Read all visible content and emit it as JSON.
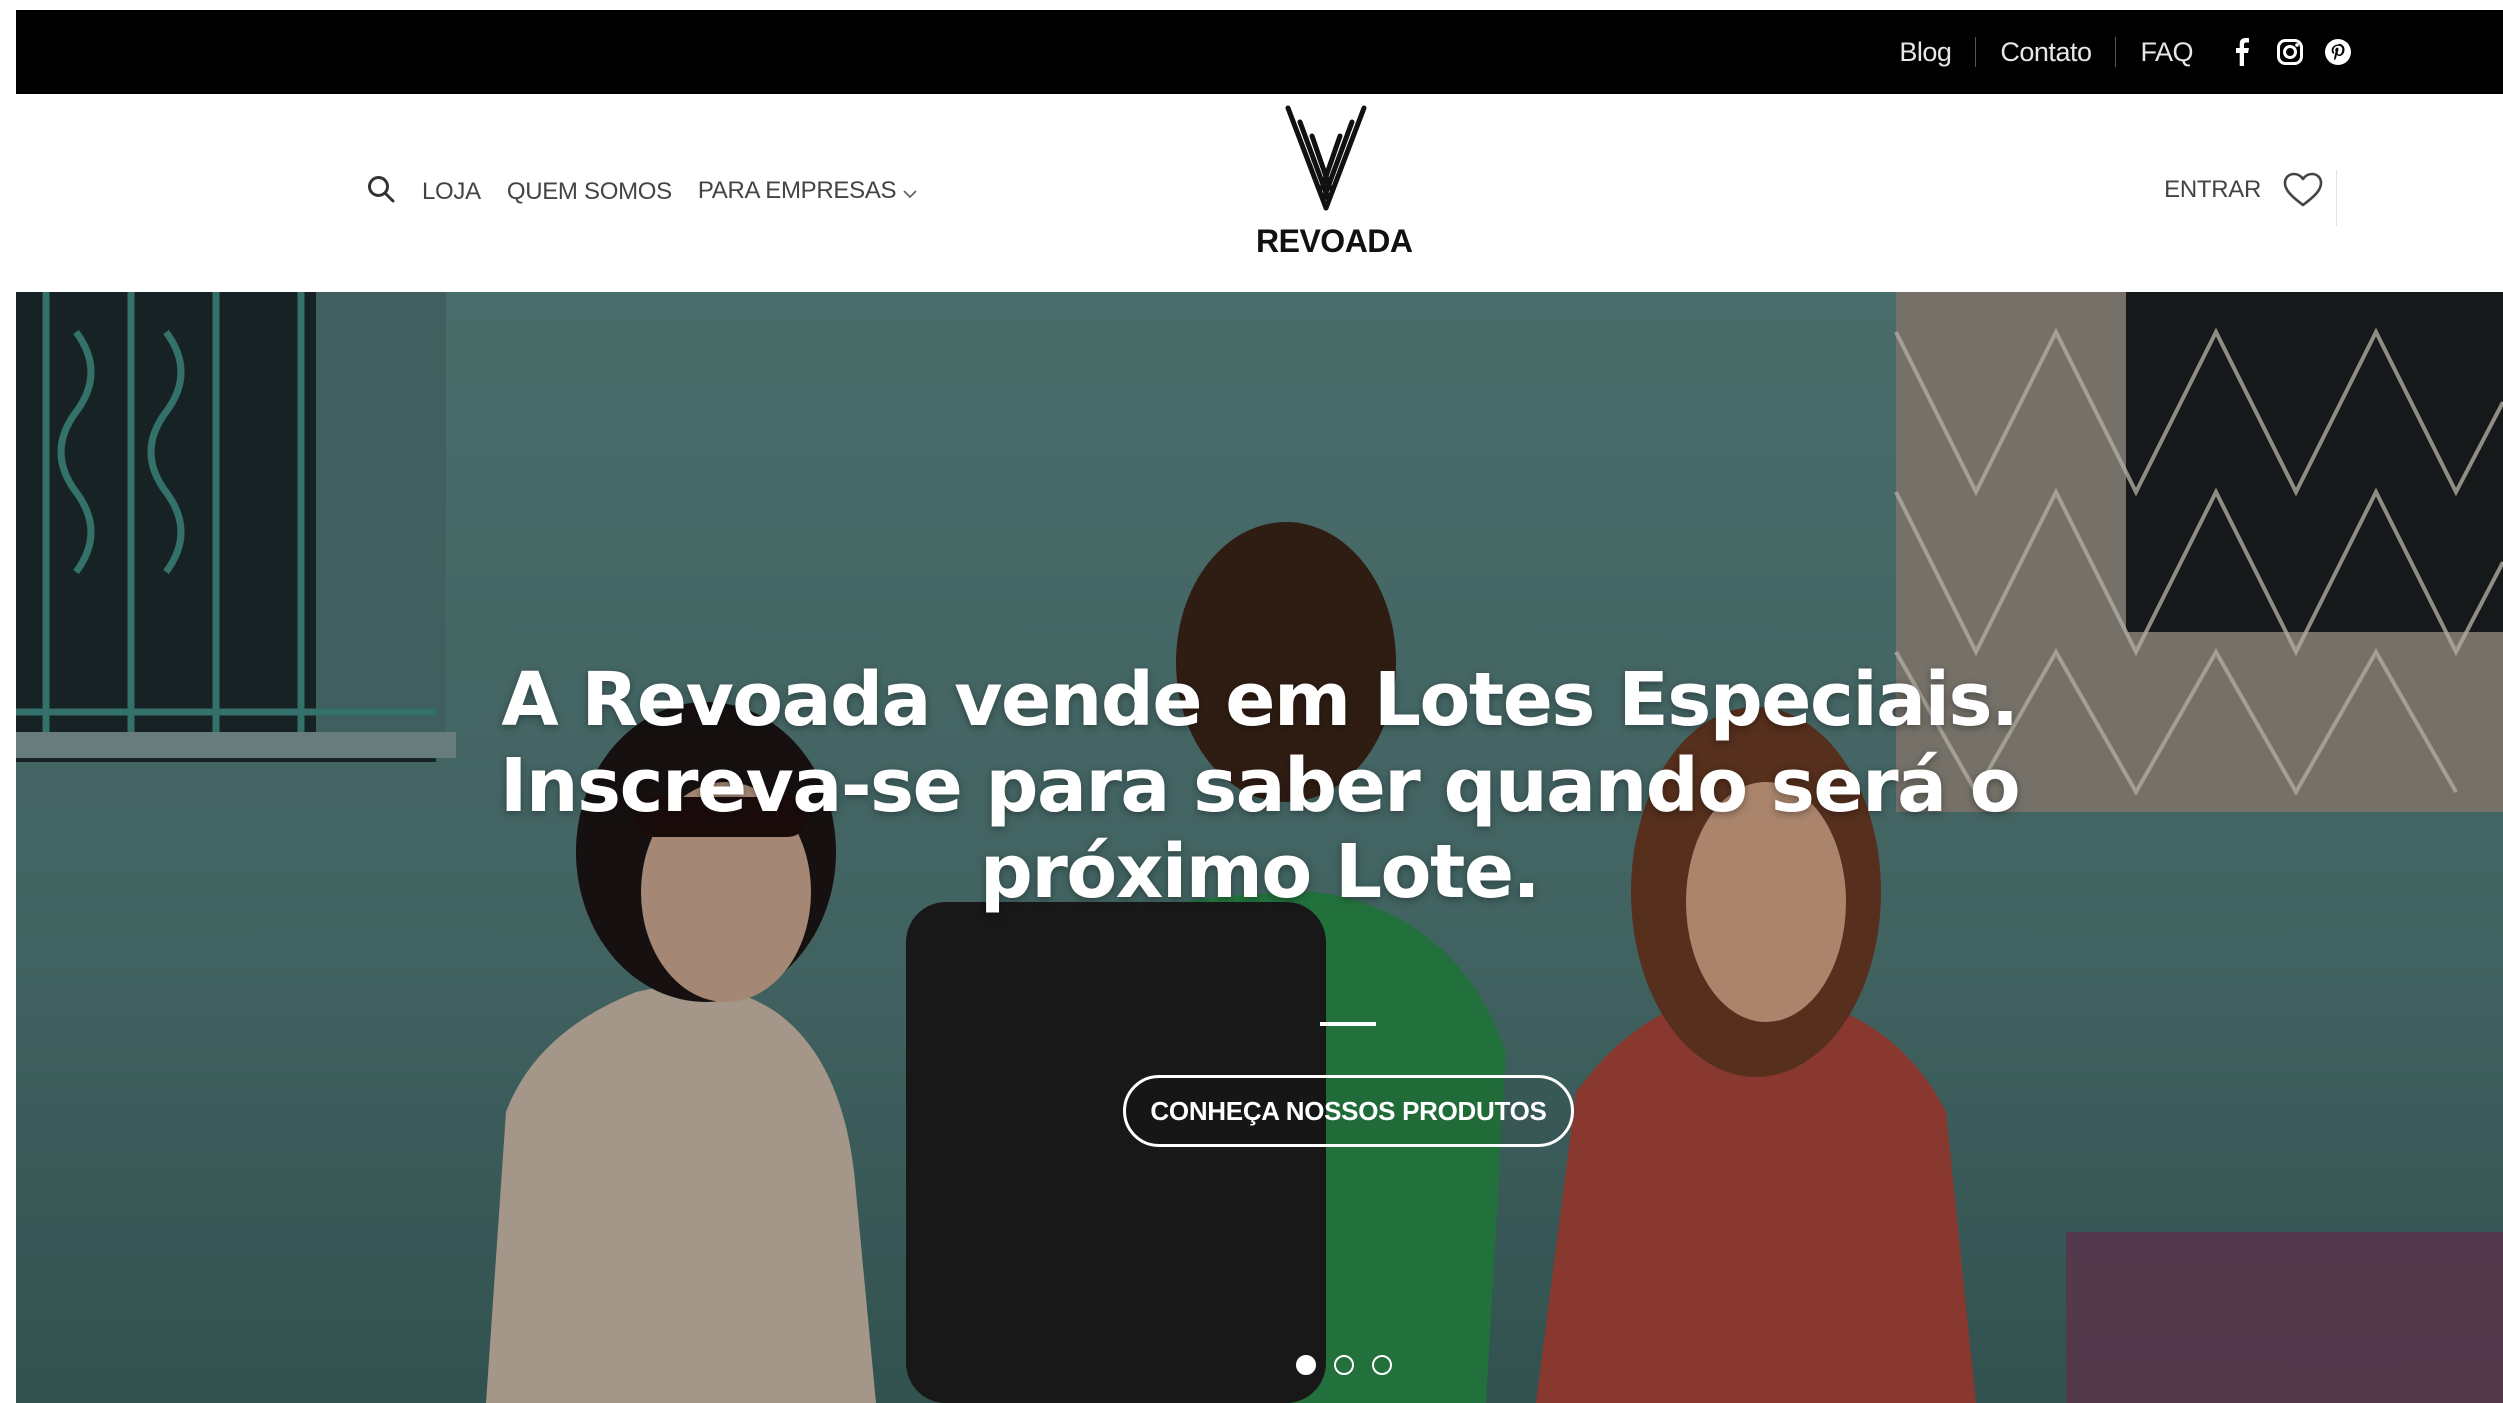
{
  "topbar": {
    "links": [
      "Blog",
      "Contato",
      "FAQ"
    ],
    "social_icons": [
      "facebook-icon",
      "instagram-icon",
      "pinterest-icon"
    ]
  },
  "header": {
    "search_icon": "search-icon",
    "nav": [
      "LOJA",
      "QUEM SOMOS",
      "PARA EMPRESAS"
    ],
    "logo_text": "REVOADA",
    "login_label": "ENTRAR",
    "wishlist_icon": "heart-icon"
  },
  "hero": {
    "headline_lines": [
      "A Revoada vende em Lotes Especiais.",
      "Inscreva-se para saber quando será o",
      "próximo Lote."
    ],
    "cta_label": "CONHEÇA NOSSOS PRODUTOS",
    "slides_total": 3,
    "active_slide": 1
  },
  "colors": {
    "topbar_bg": "#000000",
    "header_bg": "#ffffff",
    "hero_tint": "#4b7574",
    "text_light": "#ffffff",
    "nav_text": "#444444"
  }
}
